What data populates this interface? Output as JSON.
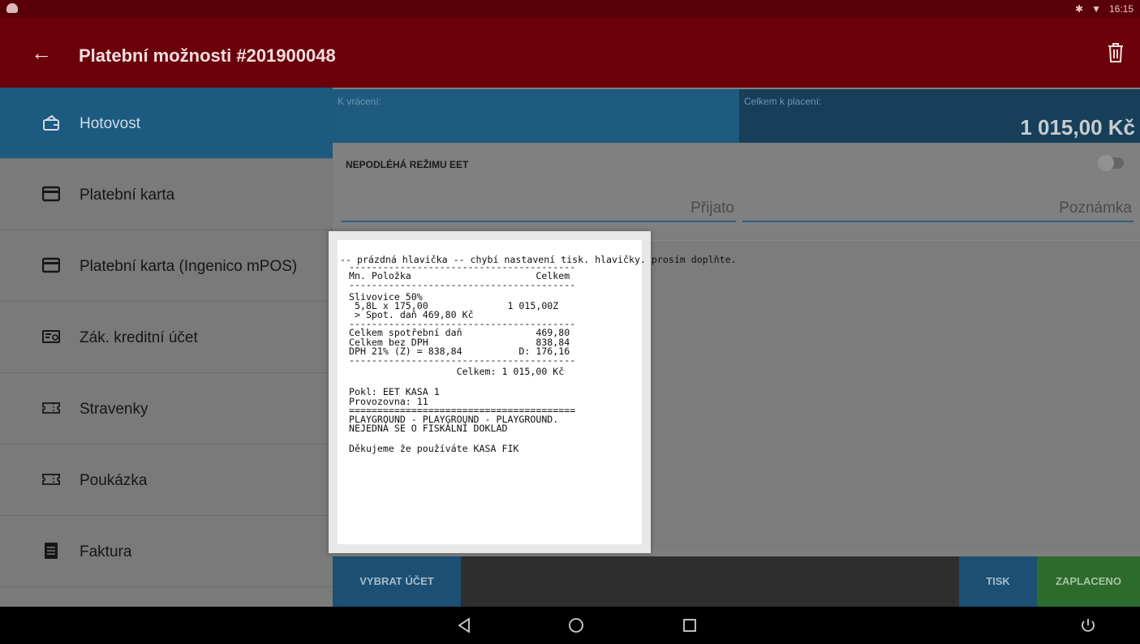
{
  "status_bar": {
    "time": "16:15"
  },
  "app_bar": {
    "title": "Platební možnosti #201900048"
  },
  "sidebar": {
    "items": [
      {
        "label": "Hotovost",
        "icon": "wallet-icon"
      },
      {
        "label": "Platební karta",
        "icon": "credit-card-icon"
      },
      {
        "label": "Platební karta (Ingenico mPOS)",
        "icon": "credit-card-icon"
      },
      {
        "label": "Zák. kreditní účet",
        "icon": "account-card-icon"
      },
      {
        "label": "Stravenky",
        "icon": "ticket-icon"
      },
      {
        "label": "Poukázka",
        "icon": "ticket-icon"
      },
      {
        "label": "Faktura",
        "icon": "invoice-icon"
      }
    ]
  },
  "summary": {
    "k_vraceni_label": "K vrácení:",
    "celkem_label": "Celkem k placení:",
    "celkem_value": "1 015,00 Kč"
  },
  "eet": {
    "label": "NEPODLÉHÁ REŽIMU EET",
    "prijato_placeholder": "Přijato",
    "poznamka_placeholder": "Poznámka"
  },
  "buttons": {
    "vybrat_ucet": "VYBRAT ÚČET",
    "tisk": "TISK",
    "zaplaceno": "ZAPLACENO"
  },
  "receipt": {
    "header": "-- prázdná hlavička -- chybí nastavení tisk. hlavičky. prosím doplňte.",
    "lines": [
      "----------------------------------------",
      "Mn. Položka                      Celkem",
      "----------------------------------------",
      "Slivovice 50%",
      " 5,8L x 175,00              1 015,00Z",
      " > Spot. daň 469,80 Kč",
      "----------------------------------------",
      "Celkem spotřební daň             469,80",
      "Celkem bez DPH                   838,84",
      "DPH 21% (Z) = 838,84          D: 176,16",
      "----------------------------------------",
      "                   Celkem: 1 015,00 Kč",
      "",
      "Pokl: EET KASA 1",
      "Provozovna: 11",
      "========================================",
      "PLAYGROUND - PLAYGROUND - PLAYGROUND.",
      "NEJEDNÁ SE O FISKÁLNÍ DOKLAD",
      "",
      "Děkujeme že používáte KASA FIK"
    ]
  }
}
